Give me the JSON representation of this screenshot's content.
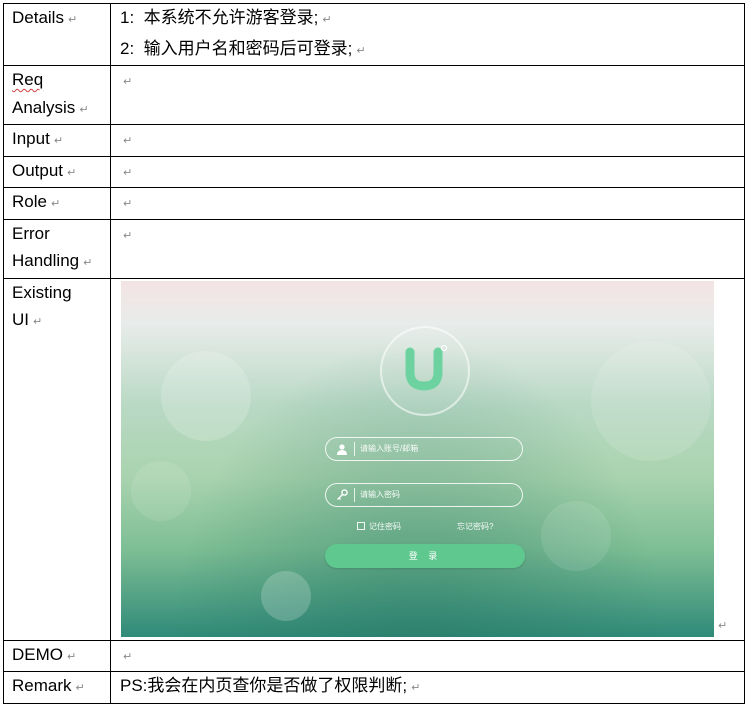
{
  "rows": {
    "details": {
      "label": "Details",
      "lines": [
        "1:  本系统不允许游客登录;",
        "2:  输入用户名和密码后可登录;"
      ]
    },
    "req_analysis": {
      "label_1": "Req",
      "label_2": "Analysis"
    },
    "input": {
      "label": "Input"
    },
    "output": {
      "label": "Output"
    },
    "role": {
      "label": "Role"
    },
    "error_handling": {
      "label_1": "Error",
      "label_2": "Handling"
    },
    "existing_ui": {
      "label_1": "Existing",
      "label_2": "UI",
      "screenshot": {
        "username_placeholder": "请输入账号/邮箱",
        "password_placeholder": "请输入密码",
        "remember_label": "记住密码",
        "forgot_label": "忘记密码?",
        "login_label": "登 录",
        "brand_color": "#6cd3a0"
      }
    },
    "demo": {
      "label": "DEMO"
    },
    "remark": {
      "label": "Remark",
      "text": "PS:我会在内页查你是否做了权限判断;"
    }
  },
  "paragraph_mark": "↵"
}
